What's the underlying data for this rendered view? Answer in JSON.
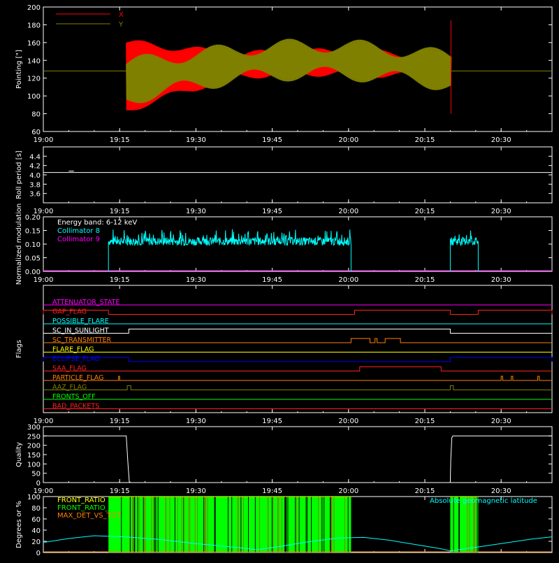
{
  "time_axis": {
    "ticks": [
      "19:00",
      "19:15",
      "19:30",
      "19:45",
      "20:00",
      "20:15",
      "20:30"
    ],
    "tick_minutes": [
      0,
      15,
      30,
      45,
      60,
      75,
      90
    ],
    "range_minutes": [
      0,
      100
    ]
  },
  "colors": {
    "background": "#000000",
    "axes": "#ffffff",
    "x_series": "#ff0000",
    "y_series": "#808000",
    "collimator8": "#00ffff",
    "collimator9": "#ff00ff",
    "green": "#00ff00",
    "orange": "#ff8000",
    "yellow": "#ffff00"
  },
  "chart_data": [
    {
      "id": "pointing",
      "type": "line",
      "ylabel": "Pointing [\"]",
      "ylim": [
        60,
        200
      ],
      "yticks": [
        "60",
        "80",
        "100",
        "120",
        "140",
        "160",
        "180",
        "200"
      ],
      "legend": [
        "X",
        "Y"
      ],
      "baseline": 128,
      "active_range_min": [
        16.3,
        80.2
      ],
      "series": [
        {
          "name": "X",
          "color": "#ff0000",
          "start_center": 122,
          "start_amp": 38,
          "end_center": 132,
          "end_amp": 12
        },
        {
          "name": "Y",
          "color": "#808000",
          "start_center": 120,
          "start_amp": 20,
          "end_center": 125,
          "end_amp": 16
        }
      ]
    },
    {
      "id": "roll",
      "type": "line",
      "ylabel": "Roll period [s]",
      "ylim": [
        3.4,
        4.6
      ],
      "yticks": [
        "3.6",
        "3.8",
        "4.0",
        "4.2",
        "4.4"
      ],
      "value": 4.05
    },
    {
      "id": "modulation",
      "type": "line",
      "ylabel": "Normalized modulation",
      "ylim": [
        0,
        0.2
      ],
      "yticks": [
        "0.00",
        "0.05",
        "0.10",
        "0.15",
        "0.20"
      ],
      "legend": [
        "Energy band: 6-12 keV",
        "Collimator 8",
        "Collimator 9"
      ],
      "collimator8_active_min": [
        [
          12.8,
          60.5
        ],
        [
          80.0,
          85.5
        ]
      ],
      "collimator8_level": 0.11
    },
    {
      "id": "flags",
      "type": "line",
      "ylabel": "Flags",
      "flags": [
        {
          "name": "ATTENUATOR_STATE",
          "color": "#ff00ff",
          "segments": []
        },
        {
          "name": "GAP_FLAG",
          "color": "#ff2020",
          "segments": [
            [
              0,
              12.8
            ],
            [
              61.2,
              80
            ],
            [
              85.5,
              100
            ]
          ]
        },
        {
          "name": "POSSIBLE_FLARE",
          "color": "#00ffff",
          "segments": []
        },
        {
          "name": "SC_IN_SUNLIGHT",
          "color": "#ffffff",
          "segments": [
            [
              16.8,
              80
            ]
          ]
        },
        {
          "name": "SC_TRANSMITTER",
          "color": "#ff8000",
          "segments": [
            [
              60.5,
              64.2
            ],
            [
              65.2,
              65.6
            ],
            [
              67.2,
              70.2
            ]
          ]
        },
        {
          "name": "FLARE_FLAG",
          "color": "#ffff00",
          "segments": []
        },
        {
          "name": "ECLIPSE_FLAG",
          "color": "#0000ff",
          "segments": [
            [
              0,
              16.8
            ],
            [
              80,
              100
            ]
          ]
        },
        {
          "name": "SAA_FLAG",
          "color": "#ff2020",
          "segments": [
            [
              62.2,
              78.2
            ]
          ]
        },
        {
          "name": "PARTICLE_FLAG",
          "color": "#ff8000",
          "segments": [
            [
              14.8,
              15.0
            ],
            [
              90.0,
              90.3
            ],
            [
              92.0,
              92.3
            ],
            [
              97.2,
              97.5
            ]
          ]
        },
        {
          "name": "AAZ_FLAG",
          "color": "#808000",
          "segments": [
            [
              16.5,
              17.2
            ],
            [
              80,
              80.6
            ]
          ]
        },
        {
          "name": "FRONTS_OFF",
          "color": "#00ff00",
          "segments": []
        },
        {
          "name": "BAD_PACKETS",
          "color": "#ff2020",
          "segments": []
        }
      ]
    },
    {
      "id": "quality",
      "type": "line",
      "ylabel": "Quality",
      "ylim": [
        0,
        300
      ],
      "yticks": [
        "0",
        "50",
        "100",
        "150",
        "200",
        "250",
        "300"
      ],
      "points": [
        [
          0,
          250
        ],
        [
          16.3,
          250
        ],
        [
          16.6,
          120
        ],
        [
          16.9,
          5
        ],
        [
          17.2,
          0
        ],
        [
          80.0,
          0
        ],
        [
          80.1,
          120
        ],
        [
          80.3,
          240
        ],
        [
          80.5,
          250
        ],
        [
          100,
          250
        ]
      ]
    },
    {
      "id": "ratios",
      "type": "line",
      "ylabel": "Degrees or %",
      "ylim": [
        0,
        100
      ],
      "yticks": [
        "0",
        "20",
        "40",
        "60",
        "80",
        "100"
      ],
      "legend": [
        "FRONT_RATIO",
        "FRONT_RATIO_",
        "MAX_DET_VS_TOT"
      ],
      "annotation": "Absolute geomagnetic latitude",
      "green_active_min": [
        [
          12.8,
          60.5
        ],
        [
          80.0,
          85.5
        ]
      ],
      "latitude_points": [
        [
          0,
          18
        ],
        [
          5,
          25
        ],
        [
          10,
          30
        ],
        [
          16,
          28
        ],
        [
          22,
          24
        ],
        [
          30,
          16
        ],
        [
          38,
          9
        ],
        [
          42,
          5
        ],
        [
          46,
          10
        ],
        [
          52,
          19
        ],
        [
          58,
          26
        ],
        [
          63,
          27
        ],
        [
          68,
          22
        ],
        [
          74,
          13
        ],
        [
          78,
          7
        ],
        [
          80,
          3
        ],
        [
          84,
          8
        ],
        [
          90,
          16
        ],
        [
          96,
          24
        ],
        [
          100,
          28
        ]
      ]
    }
  ]
}
